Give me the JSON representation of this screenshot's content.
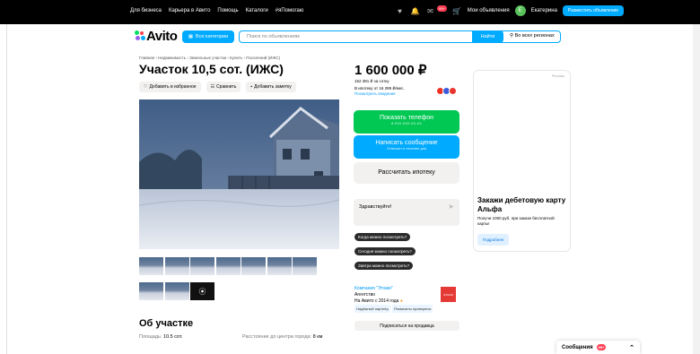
{
  "topbar": {
    "links": [
      "Для бизнеса",
      "Карьера в Авито",
      "Помощь",
      "Каталоги",
      "#яПомогаю"
    ],
    "badge_count": "99+",
    "my_listings": "Мои объявления",
    "user_initial": "Е",
    "user_name": "Екатерина",
    "post_button": "Разместить объявление"
  },
  "header": {
    "logo": "Avito",
    "categories_button": "Все категории",
    "search_placeholder": "Поиск по объявлениям",
    "search_button": "Найти",
    "region": "Во всех регионах"
  },
  "listing": {
    "breadcrumb": "Главная › Недвижимость › Земельные участки › Купить › Поселений (ИЖС)",
    "title": "Участок 10,5 сот. (ИЖС)",
    "actions": {
      "favorite": "Добавить в избранное",
      "compare": "Сравнить",
      "note": "Добавить заметку"
    },
    "section_title": "Об участке",
    "area_label": "Площадь:",
    "area_value": "10.5 сот.",
    "distance_label": "Расстояние до центра города:",
    "distance_value": "8 км"
  },
  "price": {
    "value": "1 600 000 ₽",
    "per_sotka": "152 381 ₽ за сотку",
    "mortgage": "В ипотеку от 16 289 ₽/мес.",
    "mortgage_link": "Посмотреть сведения"
  },
  "cta": {
    "show_phone": "Показать телефон",
    "show_phone_sub": "8 XXX XXX-XX-XX",
    "write_message": "Написать сообщение",
    "write_message_sub": "Отвечает в течение дня",
    "calc_mortgage": "Рассчитать ипотеку"
  },
  "chat": {
    "input_value": "Здравствуйте!",
    "questions": [
      "Когда можно посмотреть?",
      "Сегодня можно посмотреть?",
      "Завтра можно посмотреть?"
    ]
  },
  "seller": {
    "name": "Компания \"Этажи\"",
    "type": "Агентство",
    "since": "На Авито с 2014 года",
    "tags": [
      "Надёжный партнёр",
      "Реквизиты проверены"
    ],
    "subscribe": "Подписаться на продавца",
    "logo_text": "ЭТАЖИ"
  },
  "ad": {
    "label": "Реклама",
    "headline": "Закажи дебетовую карту Альфа",
    "text": "Получи 1000 руб. при заказе бесплатной карты!",
    "button": "Подробнее"
  },
  "messages": {
    "label": "Сообщения",
    "count": "99+"
  },
  "colors": {
    "accent": "#00aaff",
    "green": "#00c853",
    "dark": "#000000"
  }
}
